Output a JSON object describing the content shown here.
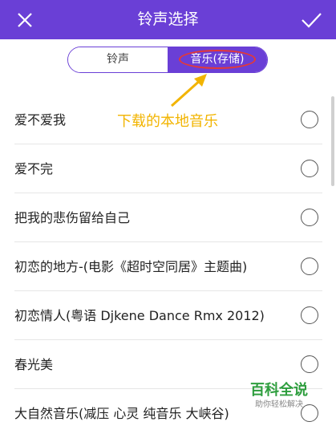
{
  "header": {
    "title": "铃声选择",
    "close_icon": "close-icon",
    "confirm_icon": "checkmark-icon",
    "background_color": "#6a3fd6"
  },
  "tabs": [
    {
      "label": "铃声",
      "selected": false
    },
    {
      "label": "音乐(存储)",
      "selected": true
    }
  ],
  "annotation": {
    "text": "下载的本地音乐",
    "color": "#f2b400",
    "highlight_color": "#e53935"
  },
  "songs": [
    {
      "title": "爱不爱我",
      "selected": false
    },
    {
      "title": "爱不完",
      "selected": false
    },
    {
      "title": "把我的悲伤留给自己",
      "selected": false
    },
    {
      "title": "初恋的地方-(电影《超时空同居》主题曲)",
      "selected": false
    },
    {
      "title": "初恋情人(粤语 Djkene Dance Rmx 2012)",
      "selected": false
    },
    {
      "title": "春光美",
      "selected": false
    },
    {
      "title": "大自然音乐(减压 心灵 纯音乐 大峡谷)",
      "selected": false
    }
  ],
  "watermark": {
    "main": "百科全说",
    "sub": "助你轻松解决"
  }
}
